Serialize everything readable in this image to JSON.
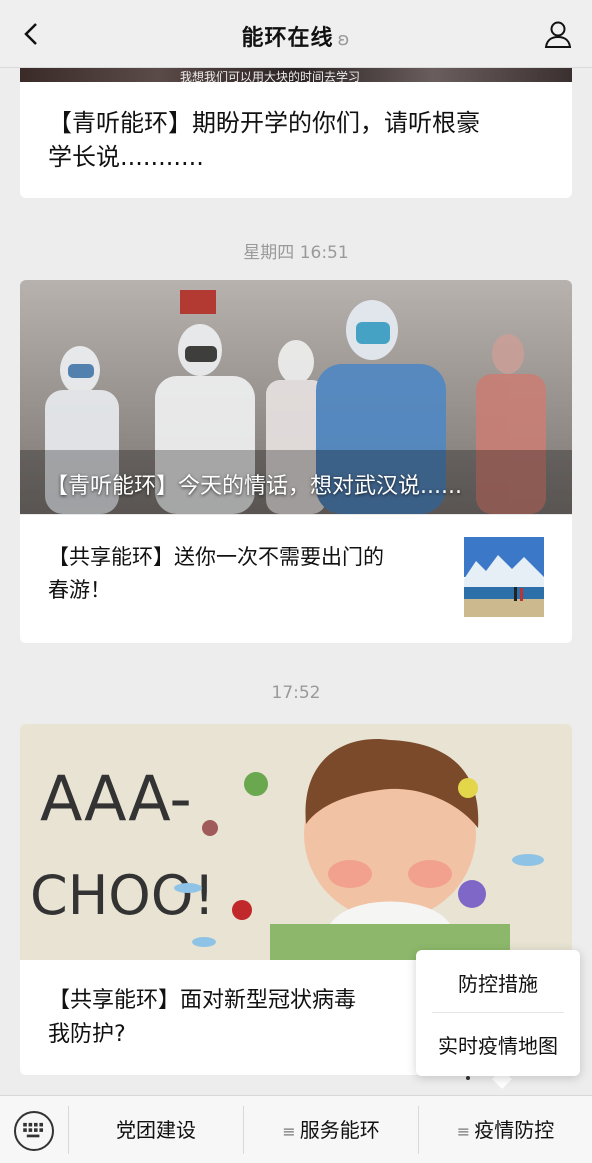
{
  "header": {
    "title": "能环在线",
    "back_icon": "chevron-left-icon",
    "ear_icon": "ear-icon",
    "profile_icon": "person-icon"
  },
  "feed": {
    "top_card": {
      "caption_partial": "我想我们可以用大块的时间去学习",
      "title_line1": "【青听能环】期盼开学的你们，请听根豪",
      "title_line2": "学长说..........."
    },
    "time1": "星期四 16:51",
    "mid_card": {
      "hero_caption": "【青听能环】今天的情话，想对武汉说......",
      "sub_title_line1": "【共享能环】送你一次不需要出门的",
      "sub_title_line2": "春游！"
    },
    "time2": "17:52",
    "bottom_card": {
      "hero_text1": "AAA-",
      "hero_text2": "CHOO!",
      "title_line1": "【共享能环】面对新型冠状病毒",
      "title_line2": "我防护?"
    }
  },
  "popup_menu": {
    "items": [
      "防控措施",
      "实时疫情地图"
    ]
  },
  "menubar": {
    "keyboard_icon": "keyboard-icon",
    "buttons": [
      "党团建设",
      "服务能环",
      "疫情防控"
    ]
  }
}
